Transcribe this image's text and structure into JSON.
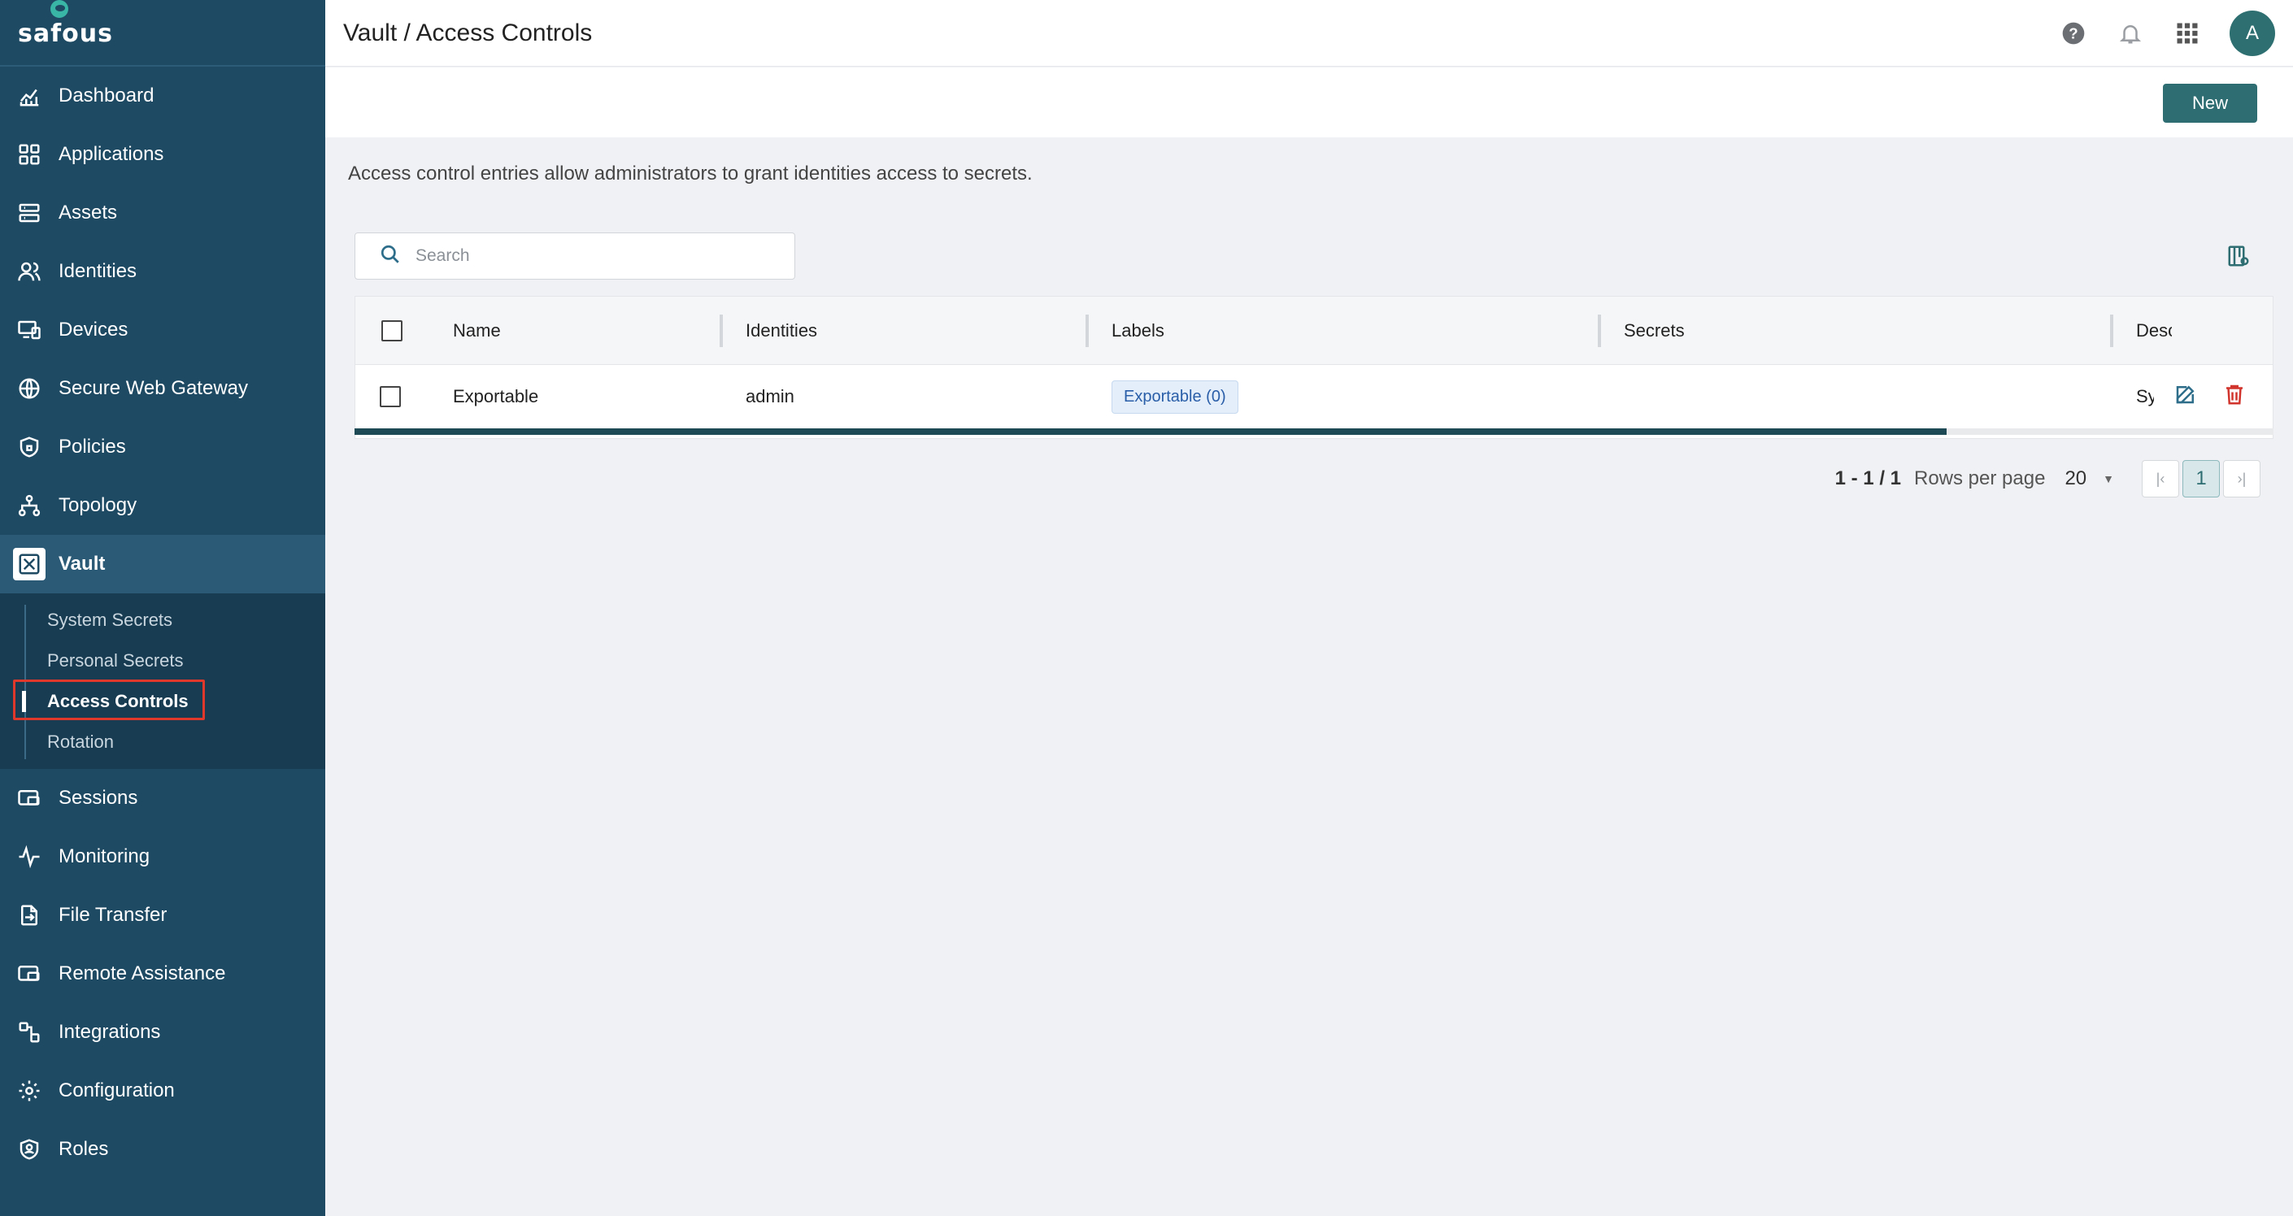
{
  "app": {
    "logo_text": "safous"
  },
  "sidebar": {
    "items": [
      {
        "label": "Dashboard",
        "icon": "chart-line-icon"
      },
      {
        "label": "Applications",
        "icon": "grid-icon"
      },
      {
        "label": "Assets",
        "icon": "server-icon"
      },
      {
        "label": "Identities",
        "icon": "users-icon"
      },
      {
        "label": "Devices",
        "icon": "devices-icon"
      },
      {
        "label": "Secure Web Gateway",
        "icon": "globe-icon"
      },
      {
        "label": "Policies",
        "icon": "shield-icon"
      },
      {
        "label": "Topology",
        "icon": "topology-icon"
      },
      {
        "label": "Vault",
        "icon": "vault-icon"
      }
    ],
    "vault_submenu": [
      "System Secrets",
      "Personal Secrets",
      "Access Controls",
      "Rotation"
    ],
    "items_after": [
      {
        "label": "Sessions",
        "icon": "sessions-icon"
      },
      {
        "label": "Monitoring",
        "icon": "pulse-icon"
      },
      {
        "label": "File Transfer",
        "icon": "file-transfer-icon"
      },
      {
        "label": "Remote Assistance",
        "icon": "remote-icon"
      },
      {
        "label": "Integrations",
        "icon": "integrations-icon"
      },
      {
        "label": "Configuration",
        "icon": "gear-icon"
      },
      {
        "label": "Roles",
        "icon": "roles-icon"
      }
    ]
  },
  "header": {
    "breadcrumb": "Vault / Access Controls",
    "avatar_letter": "A"
  },
  "toolbar": {
    "new_label": "New"
  },
  "page": {
    "description": "Access control entries allow administrators to grant identities access to secrets.",
    "search_placeholder": "Search"
  },
  "table": {
    "columns": [
      "Name",
      "Identities",
      "Labels",
      "Secrets",
      "Description"
    ],
    "rows": [
      {
        "name": "Exportable",
        "identities": "admin",
        "label": "Exportable (0)",
        "secrets": "",
        "description": "Sy"
      }
    ]
  },
  "pagination": {
    "range": "1 - 1 / 1",
    "rows_per_page_label": "Rows per page",
    "rows_per_page": "20",
    "current_page": "1"
  },
  "colors": {
    "sidebar": "#1f4a63",
    "accent": "#2e6e72",
    "delete": "#d0342c",
    "highlight": "#e0382a"
  }
}
